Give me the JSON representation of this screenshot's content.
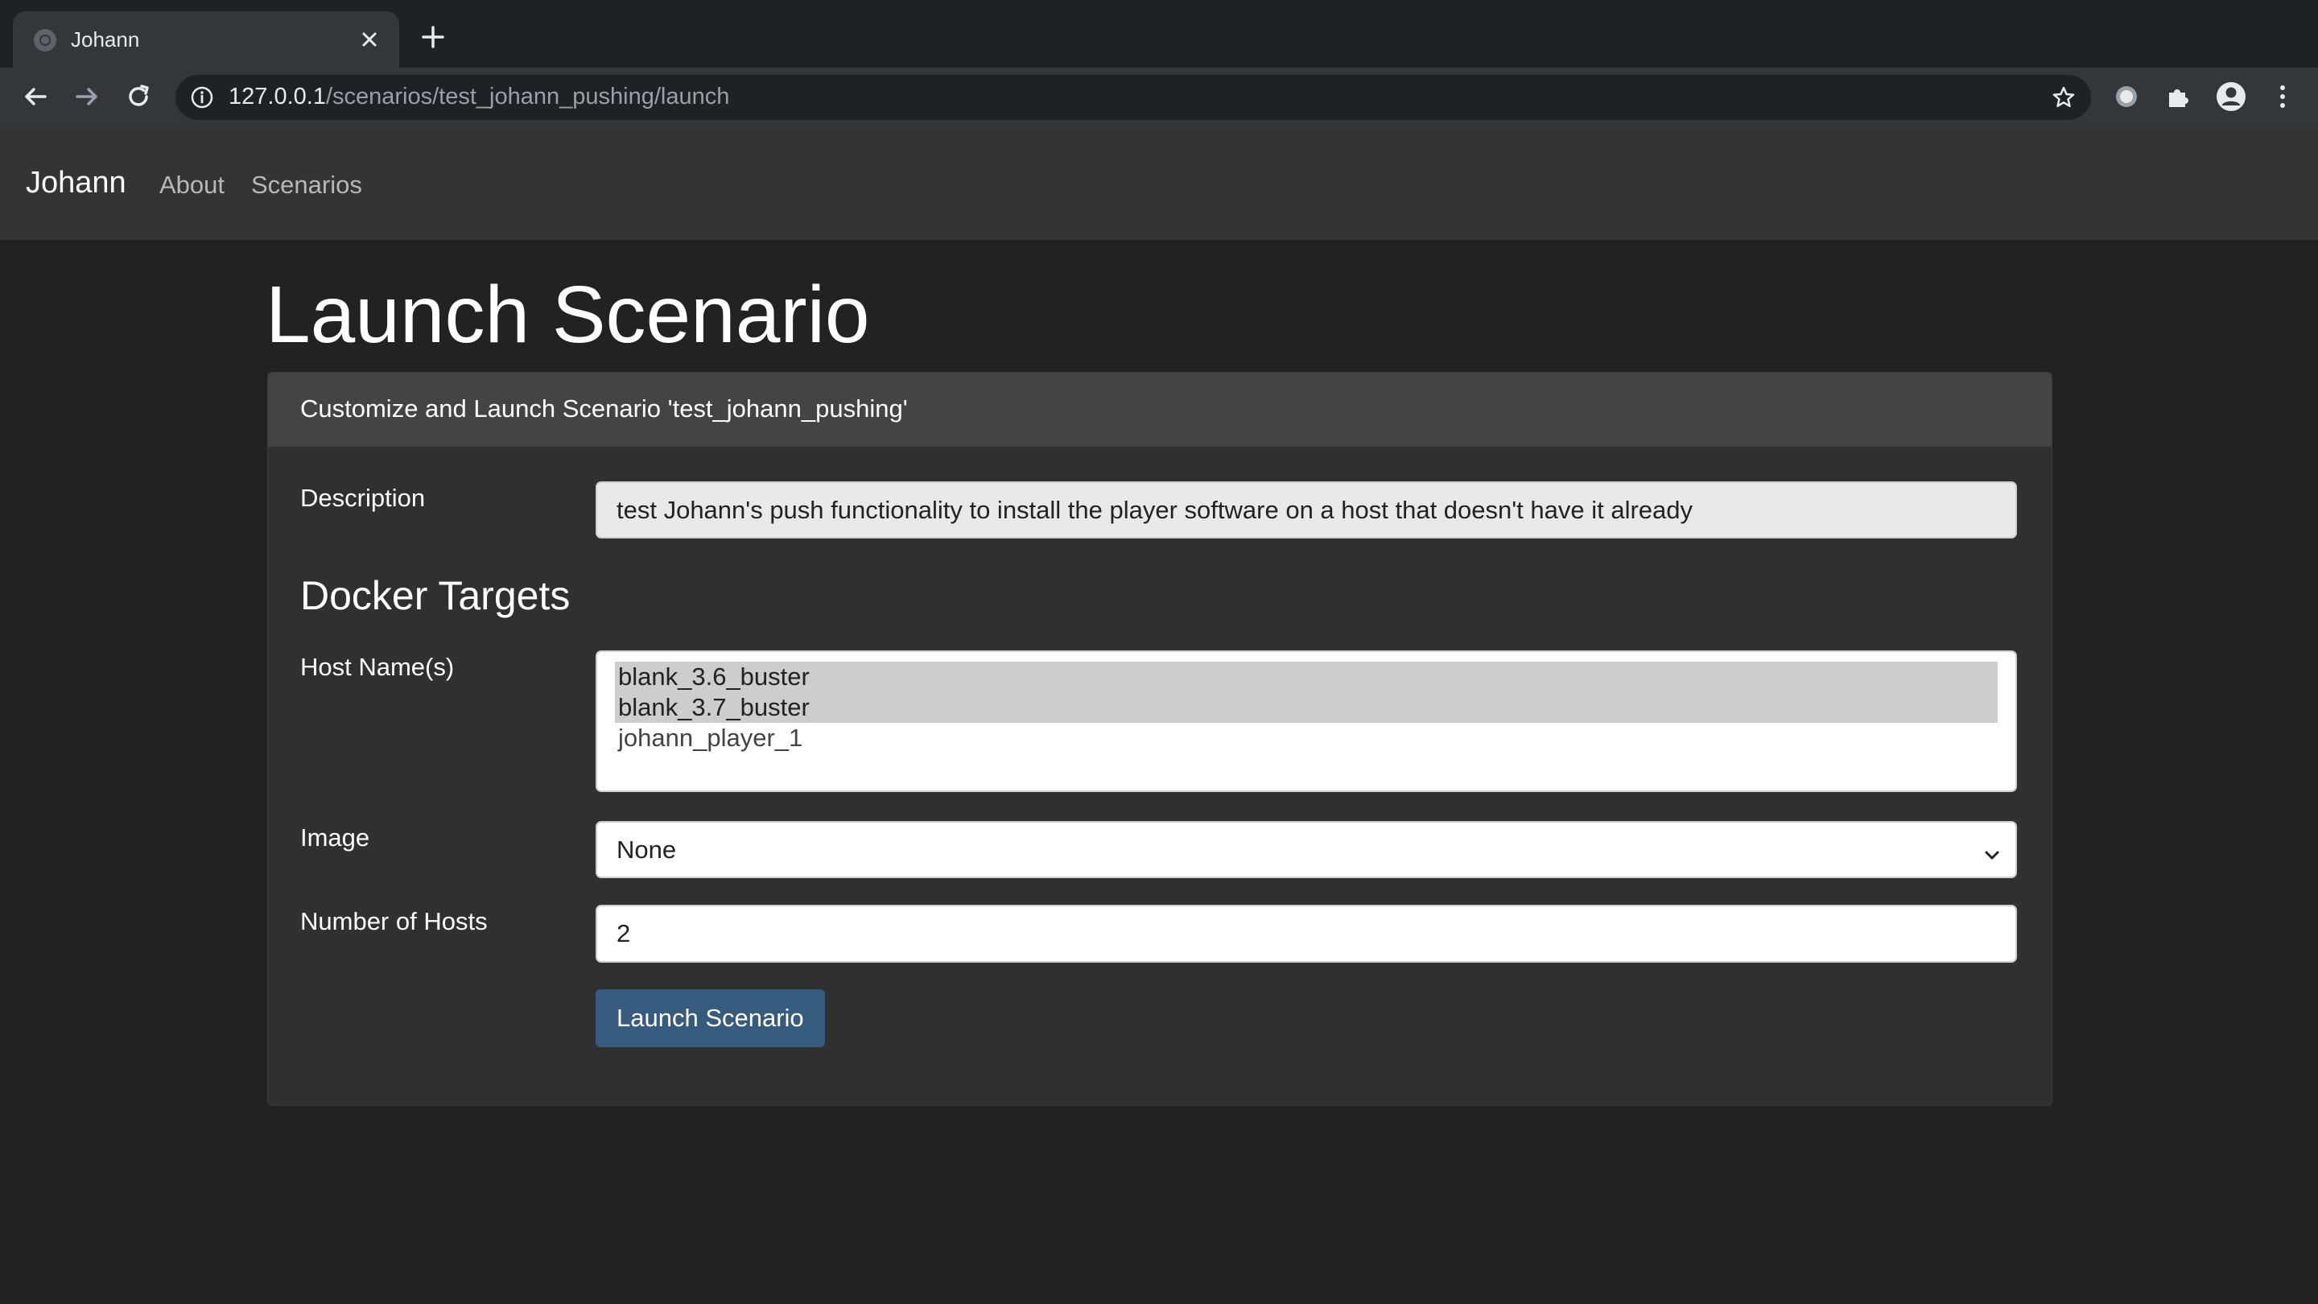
{
  "browser": {
    "tab_title": "Johann",
    "url_host": "127.0.0.1",
    "url_path": "/scenarios/test_johann_pushing/launch"
  },
  "navbar": {
    "brand": "Johann",
    "links": [
      "About",
      "Scenarios"
    ]
  },
  "page": {
    "title": "Launch Scenario"
  },
  "card": {
    "header": "Customize and Launch Scenario 'test_johann_pushing'",
    "description_label": "Description",
    "description_value": "test Johann's push functionality to install the player software on a host that doesn't have it already",
    "section_heading": "Docker Targets",
    "host_names_label": "Host Name(s)",
    "host_names_options": [
      {
        "label": "blank_3.6_buster",
        "selected": true
      },
      {
        "label": "blank_3.7_buster",
        "selected": true
      },
      {
        "label": "johann_player_1",
        "selected": false
      }
    ],
    "image_label": "Image",
    "image_value": "None",
    "num_hosts_label": "Number of Hosts",
    "num_hosts_value": "2",
    "launch_button": "Launch Scenario"
  },
  "colors": {
    "page_bg": "#222222",
    "navbar_bg": "#343434",
    "card_bg": "#303030",
    "card_header_bg": "#444444",
    "primary_button": "#375a7f"
  },
  "icons": [
    "globe-icon",
    "close-icon",
    "plus-icon",
    "back-arrow-icon",
    "forward-arrow-icon",
    "reload-icon",
    "info-icon",
    "star-icon",
    "record-icon",
    "puzzle-icon",
    "account-icon",
    "kebab-menu-icon",
    "chevron-down-icon"
  ]
}
